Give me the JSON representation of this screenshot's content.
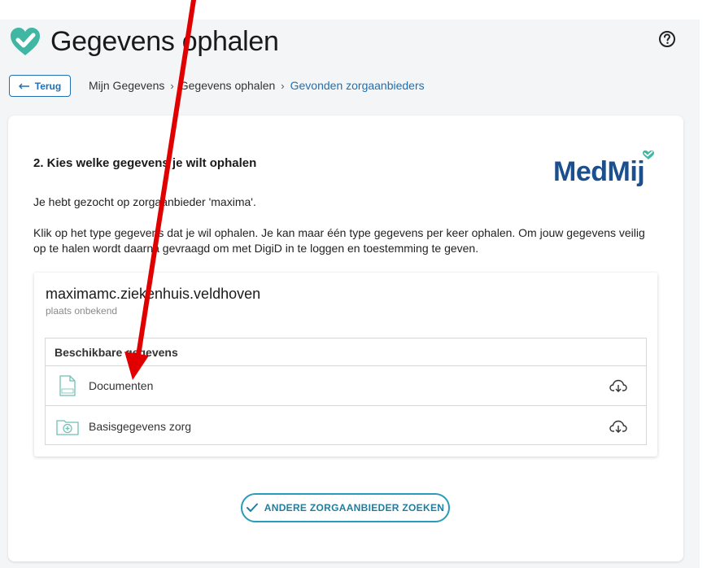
{
  "header": {
    "title": "Gegevens ophalen",
    "logo_icon": "heart-check-icon",
    "help_icon": "question-circle-icon"
  },
  "nav": {
    "back_label": "Terug",
    "breadcrumb": [
      "Mijn Gegevens",
      "Gegevens ophalen",
      "Gevonden zorgaanbieders"
    ]
  },
  "step": {
    "title": "2. Kies welke gegevens je wilt ophalen",
    "brand_logo_text": "MedMij",
    "intro": "Je hebt gezocht op zorgaanbieder 'maxima'.",
    "description": "Klik op het type gegevens dat je wil ophalen. Je kan maar één type gegevens per keer ophalen. Om jouw gegevens veilig op te halen wordt daarna gevraagd om met DigiD in te loggen en toestemming te geven."
  },
  "provider": {
    "name": "maximamc.ziekenhuis.veldhoven",
    "place": "plaats onbekend",
    "table_header": "Beschikbare gegevens",
    "rows": [
      {
        "label": "Documenten",
        "icon": "document-icon",
        "action_icon": "cloud-download-icon"
      },
      {
        "label": "Basisgegevens zorg",
        "icon": "medical-folder-icon",
        "action_icon": "cloud-download-icon"
      }
    ]
  },
  "actions": {
    "search_other": "ANDERE ZORGAANBIEDER ZOEKEN"
  },
  "colors": {
    "primary": "#1f6fb2",
    "accent": "#2a9bb9",
    "brand_heart": "#3fb7a3",
    "annotation": "#e10000"
  }
}
